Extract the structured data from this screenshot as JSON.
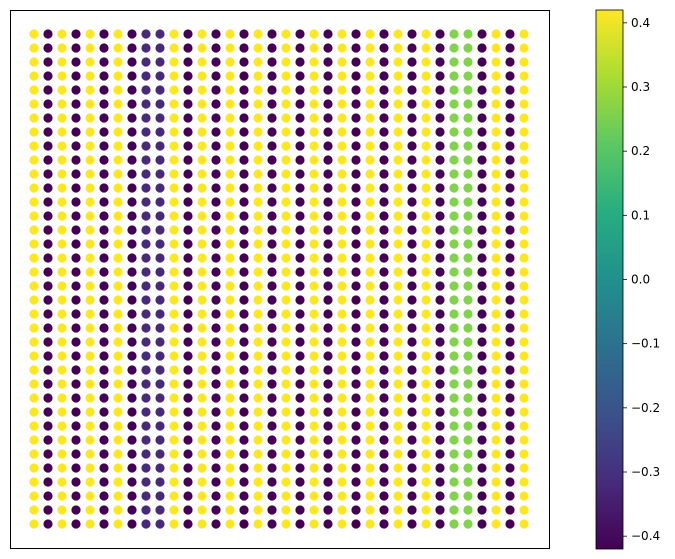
{
  "chart_data": {
    "type": "scatter",
    "title": "",
    "xlabel": "",
    "ylabel": "",
    "grid": false,
    "axes_ticks_visible": false,
    "grid_shape": {
      "rows": 36,
      "cols": 36
    },
    "column_values": [
      0.42,
      -0.42,
      0.42,
      -0.42,
      0.42,
      -0.42,
      0.42,
      -0.42,
      -0.32,
      -0.32,
      0.42,
      -0.42,
      0.42,
      -0.42,
      0.42,
      -0.42,
      0.42,
      -0.42,
      0.42,
      -0.42,
      0.42,
      -0.42,
      0.42,
      -0.42,
      0.42,
      -0.42,
      0.42,
      -0.42,
      0.42,
      -0.42,
      0.26,
      0.26,
      -0.42,
      0.42,
      -0.42,
      0.42
    ],
    "colorbar": {
      "colormap": "viridis",
      "range": [
        -0.42,
        0.42
      ],
      "ticks": [
        0.4,
        0.3,
        0.2,
        0.1,
        0.0,
        -0.1,
        -0.2,
        -0.3,
        -0.4
      ],
      "tick_labels": [
        "0.4",
        "0.3",
        "0.2",
        "0.1",
        "0.0",
        "−0.1",
        "−0.2",
        "−0.3",
        "−0.4"
      ]
    }
  }
}
